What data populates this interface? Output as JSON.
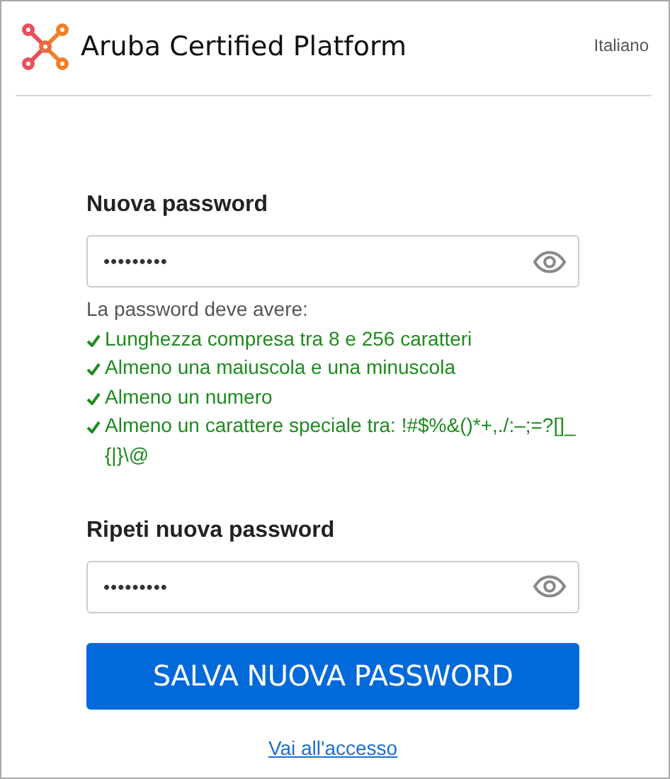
{
  "header": {
    "brand": "Aruba Certified Platform",
    "language": "Italiano"
  },
  "fields": [
    {
      "label": "Nuova password",
      "value": "•••••••••"
    },
    {
      "label": "Ripeti nuova password",
      "value": "•••••••••"
    }
  ],
  "rules": {
    "intro": "La password deve avere:",
    "items": [
      {
        "text": "Lunghezza compresa tra 8 e 256 caratteri",
        "met": true
      },
      {
        "text": "Almeno una maiuscola e una minuscola",
        "met": true
      },
      {
        "text": "Almeno un numero",
        "met": true
      },
      {
        "text": "Almeno un carattere speciale tra: !#$%&()*+,./:–;=?[]_{|}\\@",
        "met": true
      }
    ]
  },
  "submit": "SALVA NUOVA PASSWORD",
  "link": "Vai all'accesso"
}
